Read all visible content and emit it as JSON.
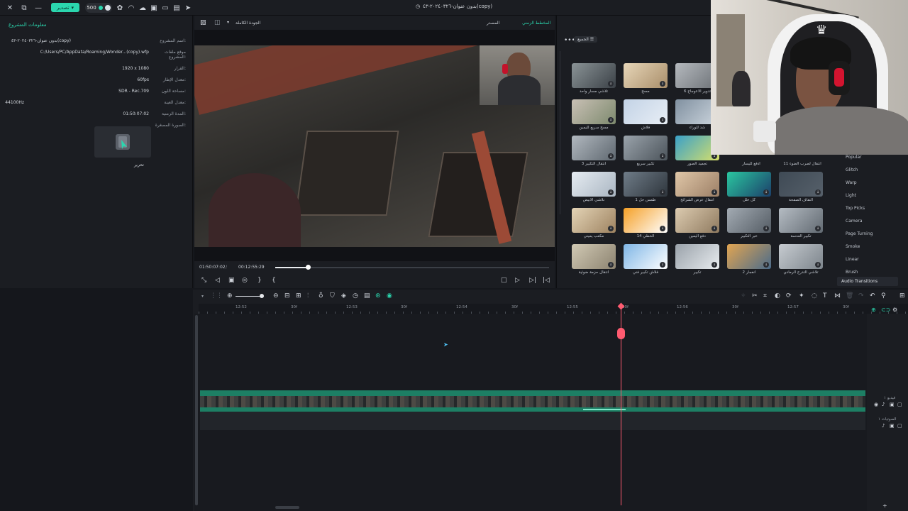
{
  "app": {
    "title": "بدون عنوان-٢٠٢٤٠٣٢٦-٤٣(copy)",
    "export_label": "تصدير",
    "credits": "500"
  },
  "project_info": {
    "tab": "معلومات المشروع",
    "rows": [
      {
        "key": "اسم المشروع:",
        "value": "بدون عنوان-٢٠٢٤٠٣٢٦-٤٣(copy)"
      },
      {
        "key": "موقع ملفات المشروع:",
        "value": "C:/Users/PC/AppData/Roaming/Wonder...(copy).wfp"
      },
      {
        "key": "القرار:",
        "value": "1920 x 1080"
      },
      {
        "key": "معدل الإطار:",
        "value": "60fps"
      },
      {
        "key": "مساحة اللون:",
        "value": "SDR - Rec.709"
      },
      {
        "key": "معدل العينة:",
        "value": "44100Hz"
      },
      {
        "key": "المدة الزمنية:",
        "value": "01:50:07:02"
      },
      {
        "key": "الصورة المصغرة:",
        "value": ""
      }
    ],
    "edit_label": "تحرير"
  },
  "player": {
    "tab_timeline": "المخطط الزمني",
    "tab_source": "المصدر",
    "quality": "الجودة الكاملة",
    "current_time": "01:50:07:02",
    "separator": "/",
    "total_time": "00:12:55:29",
    "progress": 0.12
  },
  "effects": {
    "all_label": "الجميع",
    "items": [
      {
        "label": "تلاشي مسار واحد",
        "c1": "#8a9396",
        "c2": "#3b4147"
      },
      {
        "label": "مسح",
        "c1": "#e7d6b8",
        "c2": "#a98e6a"
      },
      {
        "label": "تدوير الاعوجاج 6",
        "c1": "#b5b9be",
        "c2": "#6b7075"
      },
      {
        "label": "مسح سريع لليمين",
        "c1": "#c9c0b5",
        "c2": "#7d8a6e"
      },
      {
        "label": "فلاش",
        "c1": "#c3d3e6",
        "c2": "#e8eef5"
      },
      {
        "label": "شد للوراء",
        "c1": "#8090a0",
        "c2": "#cdd6de"
      },
      {
        "label": "انتقال التكبير 3",
        "c1": "#b1b8bf",
        "c2": "#5f6870"
      },
      {
        "label": "تكبير سريع",
        "c1": "#9aa3ab",
        "c2": "#4c545b"
      },
      {
        "label": "تجميد الصور",
        "c1": "#3aa0c8",
        "c2": "#d8e06a"
      },
      {
        "label": "تلاشي الأبيض",
        "c1": "#e6ecf2",
        "c2": "#aab6c2"
      },
      {
        "label": "طمس حل 1",
        "c1": "#6f7c88",
        "c2": "#2e353c"
      },
      {
        "label": "انتقال عرض الشرائح",
        "c1": "#e0c7a8",
        "c2": "#9c7f66"
      },
      {
        "label": "كل خلل",
        "c1": "#2ac7a0",
        "c2": "#1c3f6a"
      },
      {
        "label": "التفاف الصفحة",
        "c1": "#3f4a55",
        "c2": "#56606a"
      },
      {
        "label": "مكعب يميني",
        "c1": "#e4d4b6",
        "c2": "#9d8260"
      },
      {
        "label": "الخطي 14",
        "c1": "#f5a027",
        "c2": "#ffffff"
      },
      {
        "label": "دفع اليمين",
        "c1": "#dccbb0",
        "c2": "#8f7a5f"
      },
      {
        "label": "عبر التكبير",
        "c1": "#a3abb3",
        "c2": "#545c64"
      },
      {
        "label": "تكبير العدسة",
        "c1": "#b5bcc3",
        "c2": "#626a72"
      },
      {
        "label": "انتقال حزمة ضوئية",
        "c1": "#d1c9b4",
        "c2": "#8c8370"
      },
      {
        "label": "فلاش تكبير فني",
        "c1": "#7fb6e6",
        "c2": "#ffffff"
      },
      {
        "label": "تكبير",
        "c1": "#9aa2aa",
        "c2": "#e8ecef"
      },
      {
        "label": "انفجار 2",
        "c1": "#e1a552",
        "c2": "#4b6b8a"
      },
      {
        "label": "تلاشي التدرج الرمادي",
        "c1": "#c6cbd0",
        "c2": "#7d858c"
      }
    ],
    "partial_labels": [
      "انتقال لصرب الضوء 11",
      "ادفع لليسار"
    ],
    "categories": [
      "Popular",
      "Glitch",
      "Warp",
      "Light",
      "Top Picks",
      "Camera",
      "Page Turning",
      "Smoke",
      "Linear",
      "Brush",
      "Audio Transitions"
    ]
  },
  "timeline": {
    "ruler": [
      "12:52",
      "30f",
      "12:53",
      "30f",
      "12:54",
      "30f",
      "12:55",
      "30f",
      "12:56",
      "30f",
      "12:57",
      "30f"
    ],
    "track_video_label": "فيديو ١",
    "track_audio_label": "الصوتيات ١"
  },
  "colors": {
    "accent": "#2bd6ae",
    "playhead": "#ff5b70",
    "video_track": "#1d7f64"
  }
}
